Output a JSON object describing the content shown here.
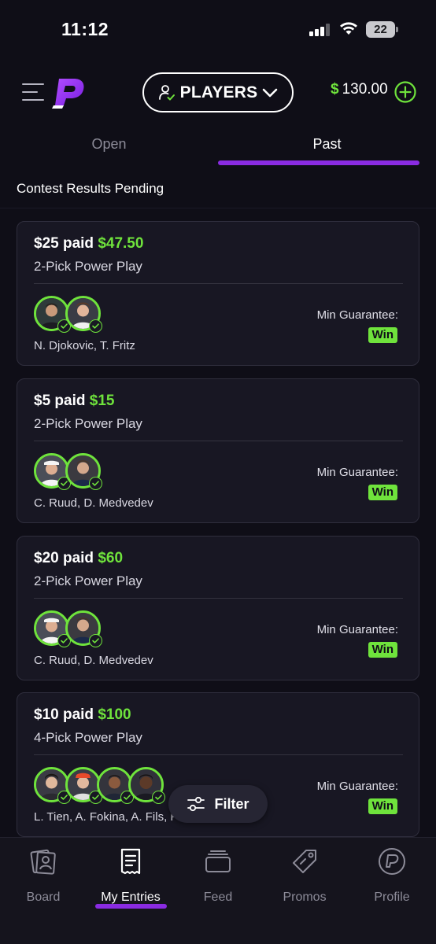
{
  "status_bar": {
    "time": "11:12",
    "battery": "22"
  },
  "header": {
    "players_label": "PLAYERS",
    "balance_currency": "$",
    "balance_amount": "130.00"
  },
  "tabs": [
    {
      "label": "Open",
      "active": false
    },
    {
      "label": "Past",
      "active": true
    }
  ],
  "section_title": "Contest Results Pending",
  "entries": [
    {
      "paid": "$25 paid",
      "payout": "$47.50",
      "type": "2-Pick Power Play",
      "players": "N. Djokovic, T. Fritz",
      "guarantee_label": "Min Guarantee:",
      "result": "Win"
    },
    {
      "paid": "$5 paid",
      "payout": "$15",
      "type": "2-Pick Power Play",
      "players": "C. Ruud, D. Medvedev",
      "guarantee_label": "Min Guarantee:",
      "result": "Win"
    },
    {
      "paid": "$20 paid",
      "payout": "$60",
      "type": "2-Pick Power Play",
      "players": "C. Ruud, D. Medvedev",
      "guarantee_label": "Min Guarantee:",
      "result": "Win"
    },
    {
      "paid": "$10 paid",
      "payout": "$100",
      "type": "4-Pick Power Play",
      "players": "L. Tien, A. Fokina, A. Fils, F",
      "guarantee_label": "Min Guarantee:",
      "result": "Win"
    }
  ],
  "filter_label": "Filter",
  "bottom_nav": [
    {
      "label": "Board",
      "icon": "board-icon",
      "active": false
    },
    {
      "label": "My Entries",
      "icon": "receipt-icon",
      "active": true
    },
    {
      "label": "Feed",
      "icon": "feed-icon",
      "active": false
    },
    {
      "label": "Promos",
      "icon": "tag-icon",
      "active": false
    },
    {
      "label": "Profile",
      "icon": "profile-logo-icon",
      "active": false
    }
  ],
  "colors": {
    "background": "#0f0e17",
    "accent_green": "#6fe33c",
    "accent_purple": "#8a2be2",
    "card": "#181723"
  }
}
